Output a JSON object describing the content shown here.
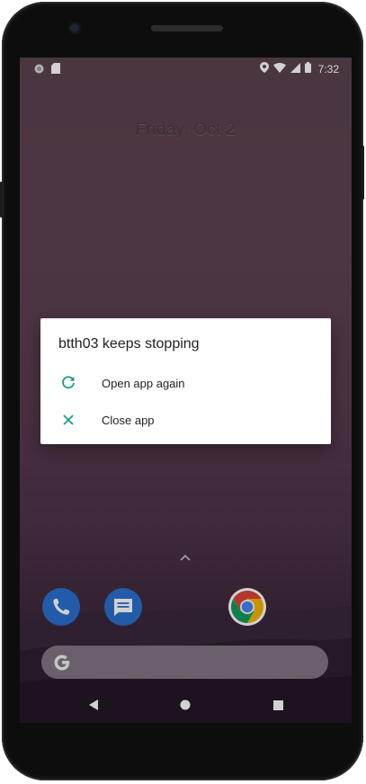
{
  "status_bar": {
    "time": "7:32",
    "left_icons": [
      "circle-notification-icon",
      "sd-card-icon"
    ],
    "right_icons": [
      "location-icon",
      "wifi-icon",
      "cell-signal-icon",
      "battery-icon"
    ]
  },
  "lockscreen": {
    "date": "Friday, Oct 2"
  },
  "dialog": {
    "title": "btth03 keeps stopping",
    "items": [
      {
        "label": "Open app again",
        "icon": "refresh-icon"
      },
      {
        "label": "Close app",
        "icon": "close-icon"
      }
    ],
    "accent_color": "#1a9e8a"
  },
  "dock": {
    "apps": [
      "phone-app-icon",
      "messages-app-icon",
      "chrome-app-icon"
    ]
  },
  "search": {
    "icon": "google-g-icon"
  },
  "nav": {
    "buttons": [
      "back-button",
      "home-button",
      "recents-button"
    ]
  }
}
